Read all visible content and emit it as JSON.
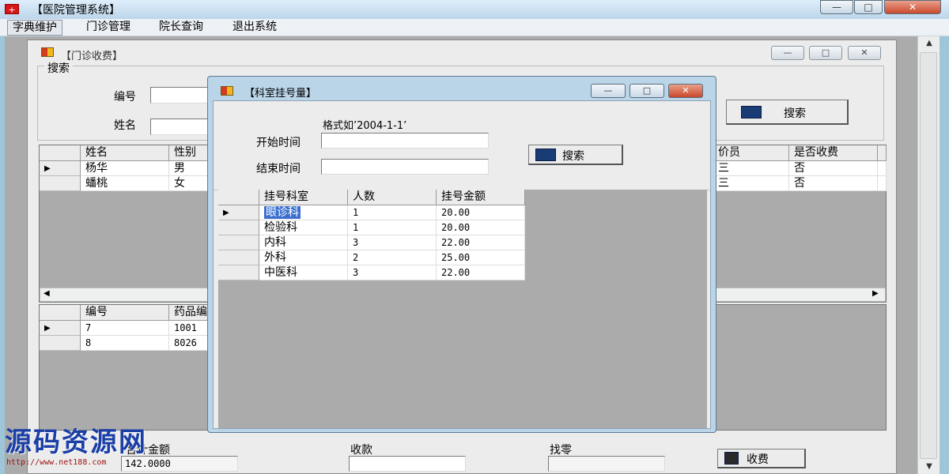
{
  "window": {
    "title": "【医院管理系统】",
    "app_icon": "+",
    "min_glyph": "—",
    "max_glyph": "□",
    "close_glyph": "✕"
  },
  "menu": {
    "items": [
      "字典维护",
      "门诊管理",
      "院长查询",
      "退出系统"
    ]
  },
  "child_form": {
    "title": "【门诊收费】",
    "controls": {
      "min": "—",
      "max": "□",
      "close": "✕"
    },
    "search_group": {
      "label": "搜索",
      "id_label": "编号",
      "name_label": "姓名",
      "id_value": "",
      "name_value": "",
      "search_button": "搜索"
    },
    "patients_grid": {
      "left_columns": [
        "姓名",
        "性别"
      ],
      "right_columns": [
        "价员",
        "是否收费"
      ],
      "rows": [
        {
          "name": "杨华",
          "gender": "男",
          "staff": "三",
          "charged": "否"
        },
        {
          "name": "蟠桃",
          "gender": "女",
          "staff": "三",
          "charged": "否"
        }
      ],
      "current_row_marker": "▶"
    },
    "scroll": {
      "left": "◀",
      "right": "▶",
      "up": "▲",
      "down": "▼"
    },
    "drugs_grid": {
      "columns": [
        "编号",
        "药品编"
      ],
      "rows": [
        {
          "id": "7",
          "code": "1001"
        },
        {
          "id": "8",
          "code": "8026"
        }
      ]
    },
    "footer": {
      "total_label": "合计金额",
      "total_value": "142.0000",
      "received_label": "收款",
      "received_value": "",
      "change_label": "找零",
      "change_value": "",
      "charge_button": "收费"
    }
  },
  "dialog": {
    "title": "【科室挂号量】",
    "controls": {
      "min": "—",
      "max": "□",
      "close": "✕"
    },
    "format_hint": "格式如’2004-1-1’",
    "start_label": "开始时间",
    "end_label": "结束时间",
    "start_value": "",
    "end_value": "",
    "search_button": "搜索",
    "grid": {
      "columns": [
        "挂号科室",
        "人数",
        "挂号金额"
      ],
      "rows": [
        {
          "dept": "眼诊科",
          "count": "1",
          "amount": "20.00"
        },
        {
          "dept": "检验科",
          "count": "1",
          "amount": "20.00"
        },
        {
          "dept": "内科",
          "count": "3",
          "amount": "22.00"
        },
        {
          "dept": "外科",
          "count": "2",
          "amount": "25.00"
        },
        {
          "dept": "中医科",
          "count": "3",
          "amount": "22.00"
        }
      ],
      "current_row_marker": "▶"
    }
  },
  "watermark": {
    "text": "源码资源网",
    "url": "http://www.net188.com"
  },
  "colors": {
    "selection": "#3a6fd0",
    "mdi_background": "#ababab"
  }
}
